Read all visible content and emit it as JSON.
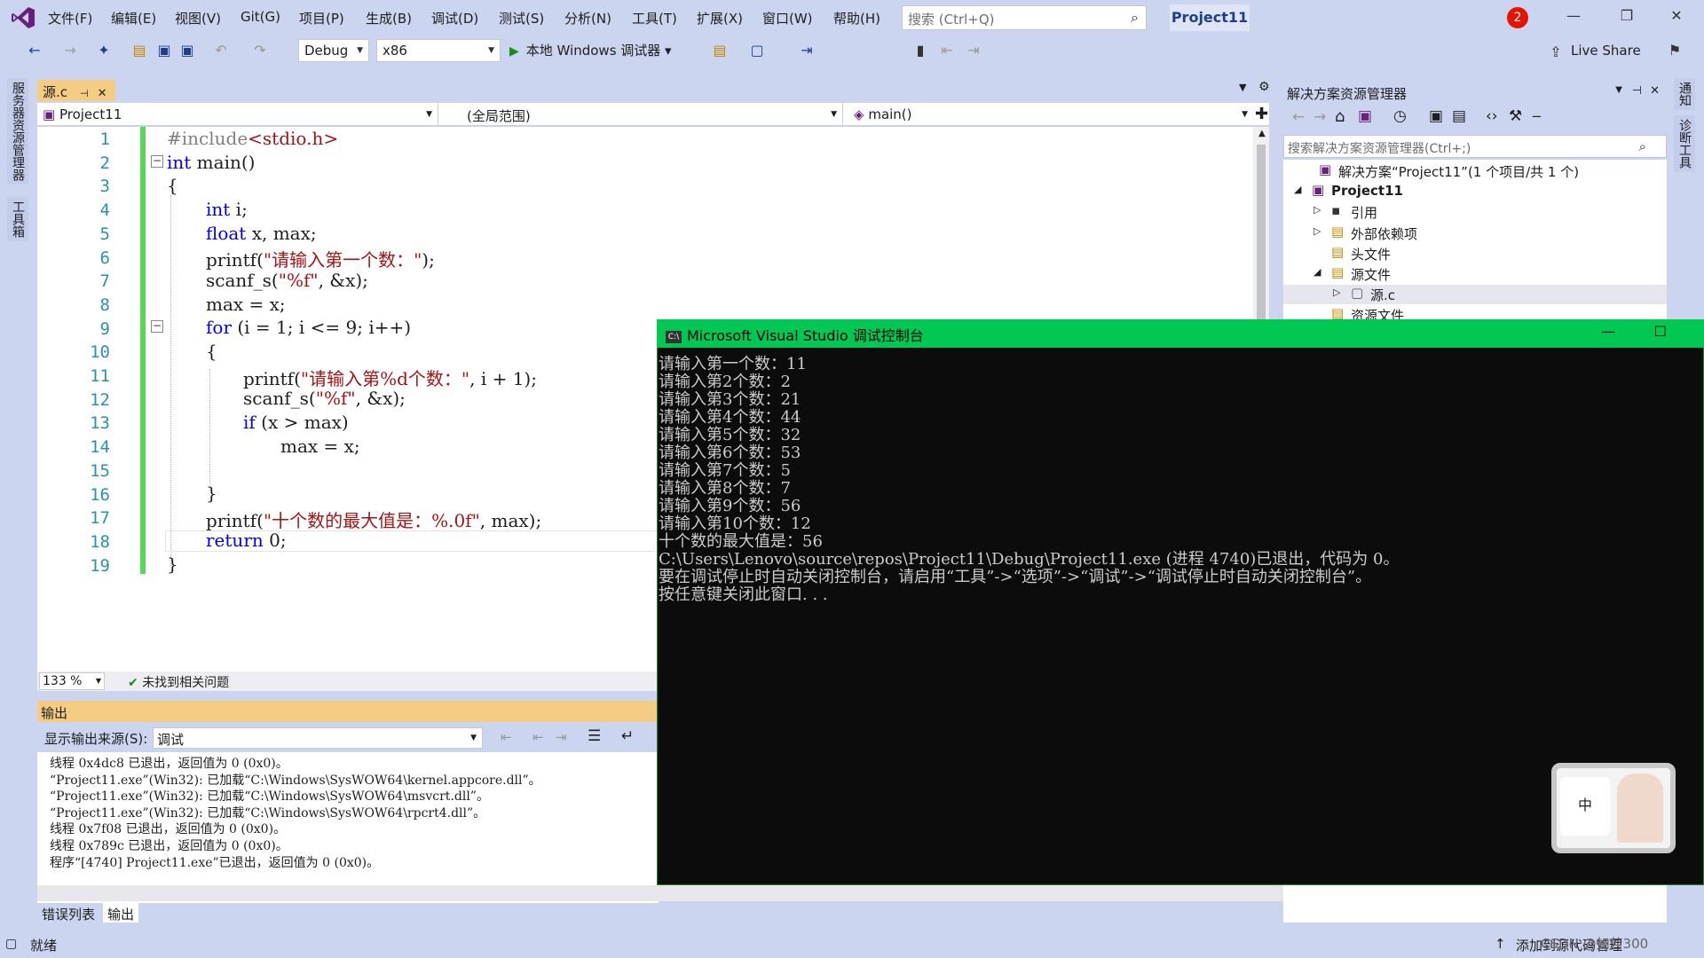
{
  "menubar": {
    "items": [
      "文件(F)",
      "编辑(E)",
      "视图(V)",
      "Git(G)",
      "项目(P)",
      "生成(B)",
      "调试(D)",
      "测试(S)",
      "分析(N)",
      "工具(T)",
      "扩展(X)",
      "窗口(W)",
      "帮助(H)"
    ],
    "search_placeholder": "搜索 (Ctrl+Q)",
    "project_title": "Project11",
    "notification_count": "2"
  },
  "toolbar": {
    "config": "Debug",
    "platform": "x86",
    "run_label": "本地 Windows 调试器",
    "live_share": "Live Share"
  },
  "left_tabs": [
    "服务器资源管理器",
    "工具箱"
  ],
  "right_tabs": [
    "通知",
    "诊断工具"
  ],
  "editor": {
    "tab_label": "源.c",
    "nav_project": "Project11",
    "nav_scope": "(全局范围)",
    "nav_member": "main()",
    "line_numbers": [
      "1",
      "2",
      "3",
      "4",
      "5",
      "6",
      "7",
      "8",
      "9",
      "10",
      "11",
      "12",
      "13",
      "14",
      "15",
      "16",
      "17",
      "18",
      "19"
    ],
    "zoom": "133 %",
    "issues": "未找到相关问题"
  },
  "output": {
    "title": "输出",
    "source_label": "显示输出来源(S):",
    "source_value": "调试",
    "lines": [
      "线程 0x4dc8 已退出，返回值为 0 (0x0)。",
      "“Project11.exe”(Win32): 已加载“C:\\Windows\\SysWOW64\\kernel.appcore.dll”。",
      "“Project11.exe”(Win32): 已加载“C:\\Windows\\SysWOW64\\msvcrt.dll”。",
      "“Project11.exe”(Win32): 已加载“C:\\Windows\\SysWOW64\\rpcrt4.dll”。",
      "线程 0x7f08 已退出，返回值为 0 (0x0)。",
      "线程 0x789c 已退出，返回值为 0 (0x0)。",
      "程序“[4740] Project11.exe”已退出，返回值为 0 (0x0)。"
    ]
  },
  "bottom_tabs": [
    "错误列表",
    "输出"
  ],
  "status": {
    "ready": "就绪",
    "right": "添加到源代码管理",
    "watermark": "CSDN @如若300"
  },
  "solution": {
    "title": "解决方案资源管理器",
    "search_placeholder": "搜索解决方案资源管理器(Ctrl+;)",
    "tree": [
      {
        "label": "解决方案“Project11”(1 个项目/共 1 个)",
        "bold": false
      },
      {
        "label": "Project11",
        "bold": true
      },
      {
        "label": "引用",
        "bold": false
      },
      {
        "label": "外部依赖项",
        "bold": false
      },
      {
        "label": "头文件",
        "bold": false
      },
      {
        "label": "源文件",
        "bold": false
      },
      {
        "label": "源.c",
        "bold": false
      },
      {
        "label": "资源文件",
        "bold": false
      }
    ]
  },
  "console": {
    "title": "Microsoft Visual Studio 调试控制台",
    "lines": [
      "请输入第一个数：11",
      "请输入第2个数：2",
      "请输入第3个数：21",
      "请输入第4个数：44",
      "请输入第5个数：32",
      "请输入第6个数：53",
      "请输入第7个数：5",
      "请输入第8个数：7",
      "请输入第9个数：56",
      "请输入第10个数：12",
      "十个数的最大值是：56",
      "C:\\Users\\Lenovo\\source\\repos\\Project11\\Debug\\Project11.exe (进程 4740)已退出，代码为 0。",
      "要在调试停止时自动关闭控制台，请启用“工具”->“选项”->“调试”->“调试停止时自动关闭控制台”。",
      "按任意键关闭此窗口. . ."
    ]
  },
  "ime": {
    "label": "中"
  },
  "code": {
    "l1a": "#include",
    "l1b": "<stdio.h>",
    "l2a": "int",
    "l2b": " main()",
    "l3": "{",
    "l4a": "int",
    "l4b": " i;",
    "l5a": "float",
    "l5b": " x, max;",
    "l6a": "printf(",
    "l6b": "\"请输入第一个数：\"",
    "l6c": ");",
    "l7a": "scanf_s(",
    "l7b": "\"%f\"",
    "l7c": ", &x);",
    "l8": "max = x;",
    "l9a": "for",
    "l9b": " (i = 1; i <= 9; i++)",
    "l10": "{",
    "l11a": "printf(",
    "l11b": "\"请输入第%d个数：\"",
    "l11c": ", i + 1);",
    "l12a": "scanf_s(",
    "l12b": "\"%f\"",
    "l12c": ", &x);",
    "l13a": "if",
    "l13b": " (x > max)",
    "l14": "max = x;",
    "l16": "}",
    "l17a": "printf(",
    "l17b": "\"十个数的最大值是：%.0f\"",
    "l17c": ", max);",
    "l18a": "return",
    "l18b": " 0;",
    "l19": "}"
  },
  "colors": {
    "accent": "#1e3d8a",
    "console_title": "#00c853",
    "doc_tab": "#f5cc84",
    "change_bar": "#57d657"
  }
}
